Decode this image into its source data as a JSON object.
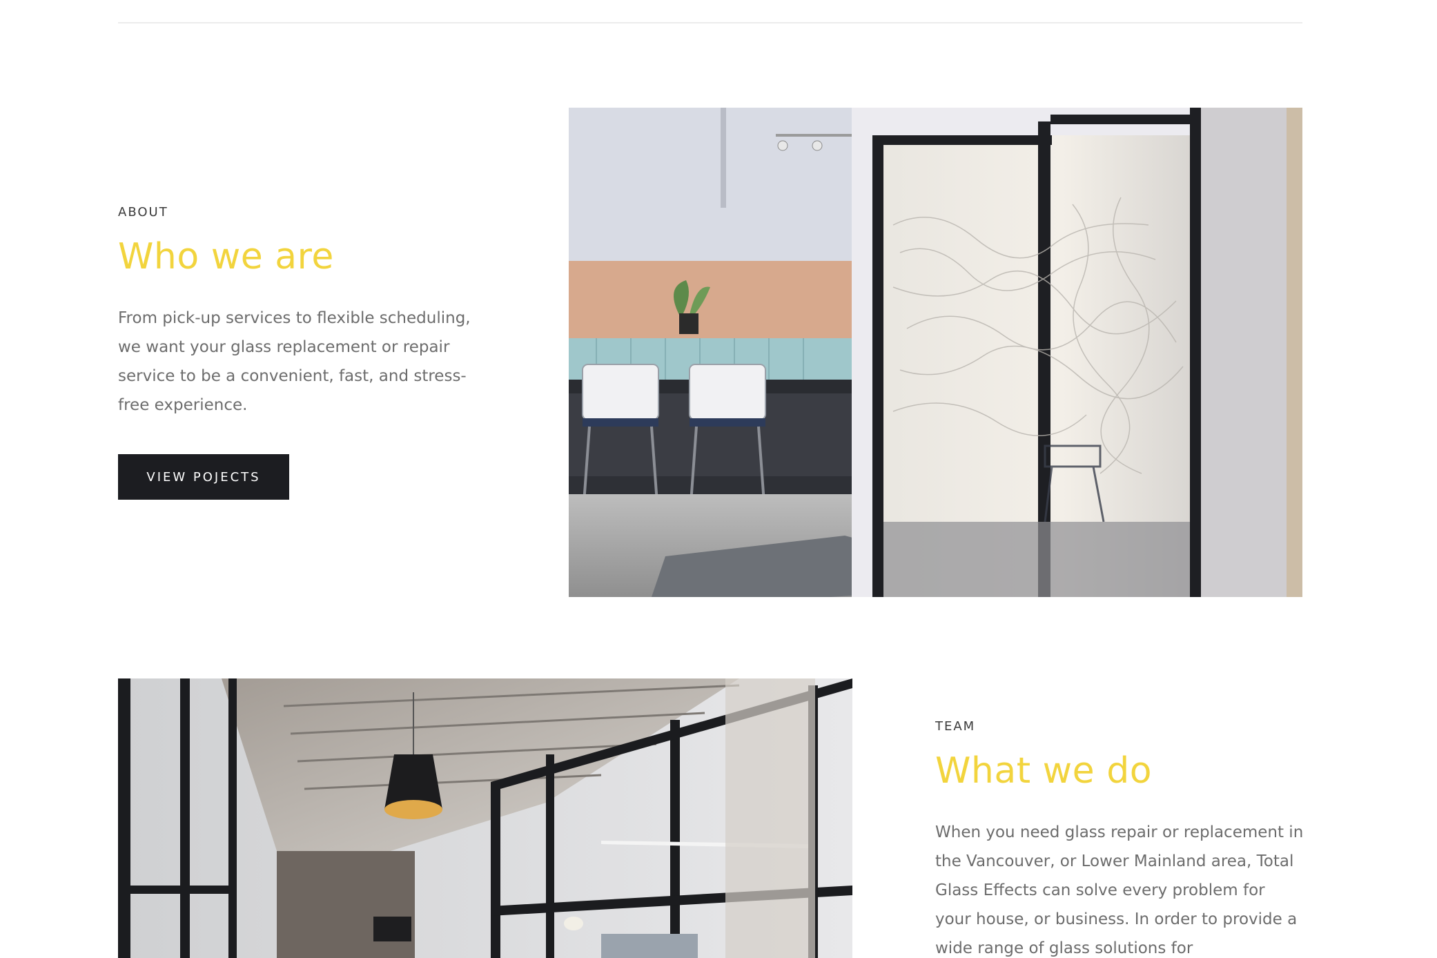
{
  "about": {
    "eyebrow": "ABOUT",
    "heading": "Who we are",
    "body": "From pick-up services to flexible scheduling, we want your glass replacement or repair service to be a convenient, fast, and stress-free experience.",
    "button_label": "VIEW POJECTS"
  },
  "team": {
    "eyebrow": "TEAM",
    "heading": "What we do",
    "body": "When you need glass repair or replacement in the Vancouver, or Lower Mainland area, Total Glass Effects can solve every problem for your house, or business. In order to provide a wide range of glass solutions for"
  },
  "colors": {
    "heading_accent": "#f2d43d",
    "button_background": "#1c1d21",
    "body_text": "#6c6c6c"
  }
}
